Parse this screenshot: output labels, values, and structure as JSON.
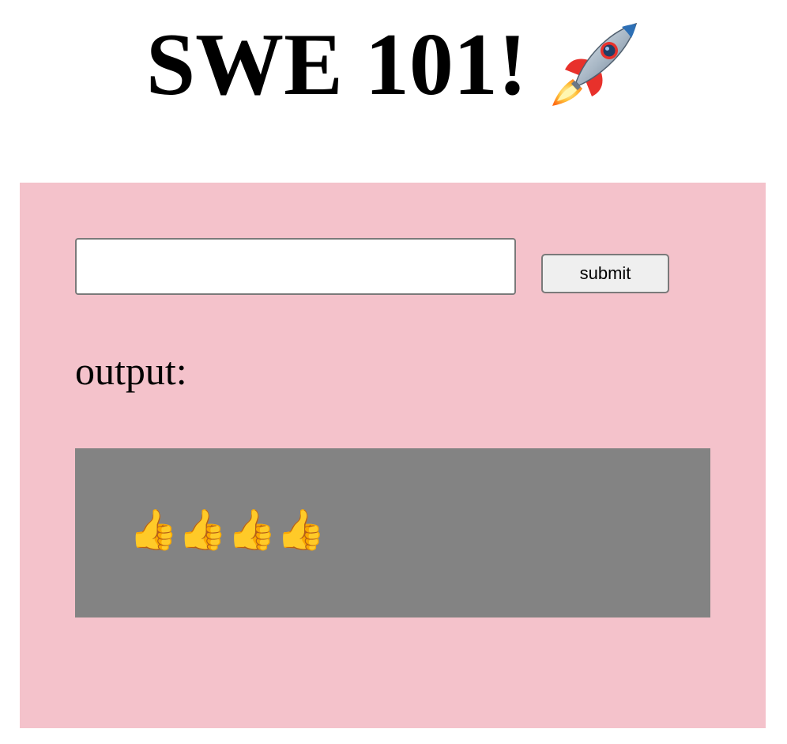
{
  "header": {
    "title": "SWE 101!",
    "title_icon": "rocket-icon"
  },
  "form": {
    "input_value": "",
    "input_placeholder": "",
    "submit_label": "submit"
  },
  "output": {
    "label": "output:",
    "value": "👍👍👍👍"
  },
  "colors": {
    "panel_background": "#f4c2cb",
    "output_background": "#838383"
  }
}
